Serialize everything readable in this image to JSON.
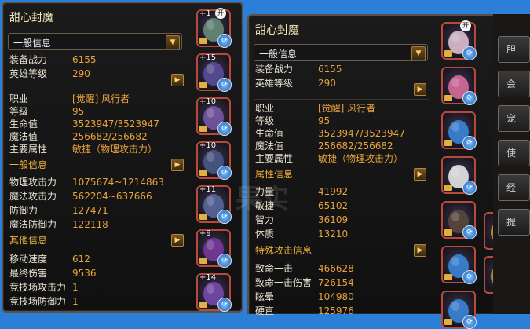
{
  "left": {
    "title": "甜心封魔",
    "dropdown": "一般信息",
    "rows1": [
      {
        "label": "装备战力",
        "value": "6155"
      },
      {
        "label": "英雄等级",
        "value": "290"
      }
    ],
    "rows2": [
      {
        "label": "职业",
        "value": "[觉醒] 风行者"
      },
      {
        "label": "等级",
        "value": "95"
      },
      {
        "label": "生命值",
        "value": "3523947/3523947"
      },
      {
        "label": "魔法值",
        "value": "256682/256682"
      },
      {
        "label": "主要属性",
        "value": "敏捷（物理攻击力）"
      }
    ],
    "section1": "一般信息",
    "rows3": [
      {
        "label": "物理攻击力",
        "value": "1075674~1214863"
      },
      {
        "label": "魔法攻击力",
        "value": "562204~637666"
      },
      {
        "label": "防御力",
        "value": "127471"
      },
      {
        "label": "魔法防御力",
        "value": "122118"
      }
    ],
    "section2": "其他信息",
    "rows4": [
      {
        "label": "移动速度",
        "value": "612"
      },
      {
        "label": "最终伤害",
        "value": "9536"
      },
      {
        "label": "竞技场攻击力",
        "value": "1"
      },
      {
        "label": "竞技场防御力",
        "value": "1"
      }
    ]
  },
  "right": {
    "title": "甜心封魔",
    "dropdown": "一般信息",
    "rows1": [
      {
        "label": "装备战力",
        "value": "6155"
      },
      {
        "label": "英雄等级",
        "value": "290"
      }
    ],
    "rows2": [
      {
        "label": "职业",
        "value": "[觉醒] 风行者"
      },
      {
        "label": "等级",
        "value": "95"
      },
      {
        "label": "生命值",
        "value": "3523947/3523947"
      },
      {
        "label": "魔法值",
        "value": "256682/256682"
      },
      {
        "label": "主要属性",
        "value": "敏捷（物理攻击力）"
      }
    ],
    "section1": "属性信息",
    "rows3": [
      {
        "label": "力量",
        "value": "41992"
      },
      {
        "label": "敏捷",
        "value": "65102"
      },
      {
        "label": "智力",
        "value": "36109"
      },
      {
        "label": "体质",
        "value": "13210"
      }
    ],
    "section2": "特殊攻击信息",
    "rows4": [
      {
        "label": "致命一击",
        "value": "466628"
      },
      {
        "label": "致命一击伤害",
        "value": "726154"
      },
      {
        "label": "眩晕",
        "value": "104980"
      },
      {
        "label": "硬直",
        "value": "125976"
      }
    ]
  },
  "equip_left": [
    {
      "level": "+1",
      "open": "开"
    },
    {
      "level": "+15"
    },
    {
      "level": "+10"
    },
    {
      "level": "+10"
    },
    {
      "level": "+11"
    },
    {
      "level": "+9"
    },
    {
      "level": "+14"
    }
  ],
  "equip_right": [
    {
      "open": "开"
    },
    {},
    {},
    {},
    {},
    {},
    {}
  ],
  "side_tabs": [
    "胆",
    "会",
    "宠",
    "使",
    "经",
    "提"
  ],
  "watermark": "果实"
}
